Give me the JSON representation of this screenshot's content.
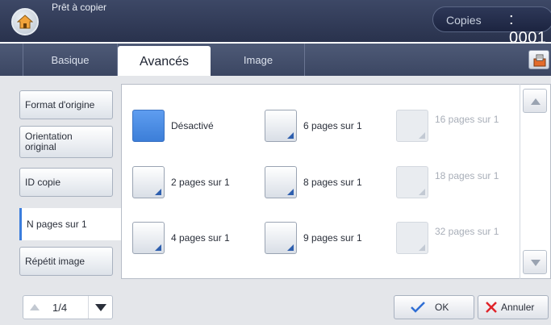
{
  "header": {
    "status": "Prêt à copier",
    "copies_label": "Copies",
    "copies_value": ": 0001"
  },
  "tabs": [
    {
      "label": "Basique"
    },
    {
      "label": "Avancés"
    },
    {
      "label": "Image"
    }
  ],
  "sidebar": {
    "items": [
      {
        "label": "Format d'origine"
      },
      {
        "label": "Orientation original"
      },
      {
        "label": "ID copie"
      },
      {
        "label": "N pages sur 1"
      },
      {
        "label": "Répétit image"
      }
    ]
  },
  "options": [
    {
      "label": "Désactivé"
    },
    {
      "label": "6 pages sur 1"
    },
    {
      "label": "16 pages sur 1"
    },
    {
      "label": "2 pages sur 1"
    },
    {
      "label": "8 pages sur 1"
    },
    {
      "label": "18 pages sur 1"
    },
    {
      "label": "4 pages sur 1"
    },
    {
      "label": "9 pages sur 1"
    },
    {
      "label": "32 pages sur 1"
    }
  ],
  "footer": {
    "page_indicator": "1/4",
    "ok_label": "OK",
    "cancel_label": "Annuler"
  },
  "colors": {
    "accent": "#3b7ddd",
    "cancel_x": "#e0242a",
    "ok_check": "#2f6ed4"
  }
}
